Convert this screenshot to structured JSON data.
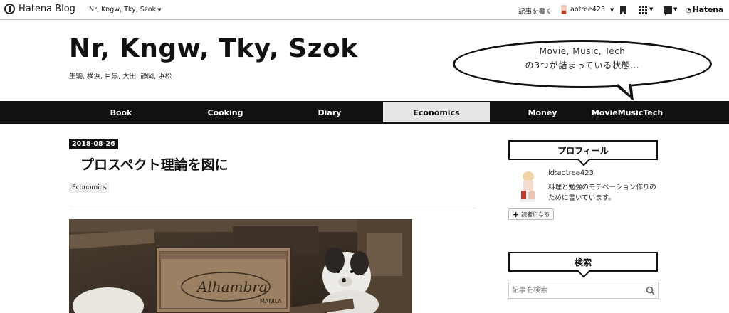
{
  "topbar": {
    "logo_text": "Hatena Blog",
    "blog_switcher": "Nr, Kngw, Tky, Szok",
    "write_label": "記事を書く",
    "user_name": "aotree423",
    "hatena_label": "Hatena",
    "icons": [
      "hatena-logo-icon",
      "bookmark-icon",
      "apps-grid-icon",
      "notification-icon",
      "hatena-wifi-icon"
    ]
  },
  "header": {
    "title": "Nr, Kngw, Tky, Szok",
    "description": "生駒, 横浜, 目黒, 大田, 静岡, 浜松",
    "bubble_line1": "Movie, Music, Tech",
    "bubble_line2": "の3つが詰まっている状態…"
  },
  "nav": {
    "items": [
      {
        "label": "Book"
      },
      {
        "label": "Cooking"
      },
      {
        "label": "Diary"
      },
      {
        "label": "Economics"
      },
      {
        "label": "Money"
      },
      {
        "label": "MovieMusicTech"
      }
    ],
    "active": "Economics"
  },
  "article": {
    "date": "2018-08-26",
    "title": "プロスペクト理論を図に",
    "category": "Economics",
    "photo_text_brand": "Alhambra",
    "photo_text_place": "MANILA"
  },
  "sidebar": {
    "profile": {
      "heading": "プロフィール",
      "id_link": "id:aotree423",
      "description": "料理と勉強のモチベーション作りのために書いています。",
      "subscribe_label": "読者になる"
    },
    "search": {
      "heading": "検索",
      "placeholder": "記事を検索"
    }
  },
  "colors": {
    "nav_bg": "#111111",
    "nav_active_bg": "#e6e6e6",
    "text": "#111111"
  }
}
